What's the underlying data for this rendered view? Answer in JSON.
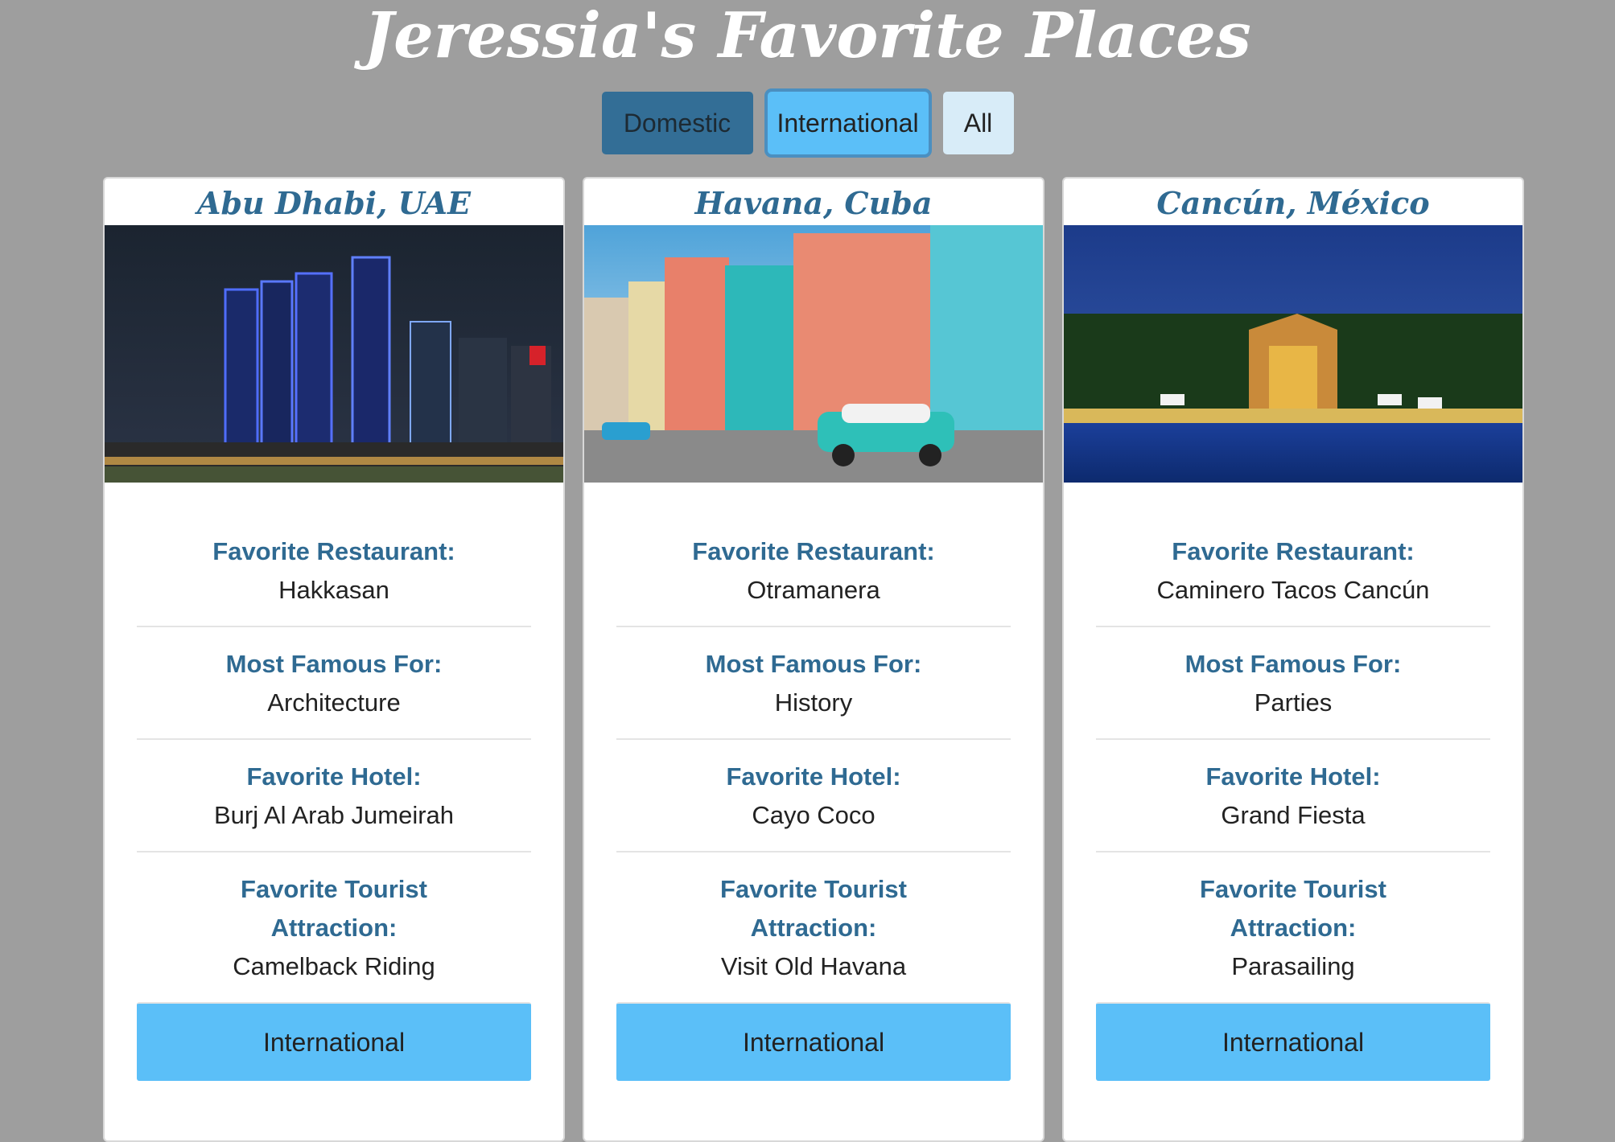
{
  "page": {
    "title": "Jeressia's Favorite Places"
  },
  "filters": {
    "domestic": "Domestic",
    "international": "International",
    "all": "All"
  },
  "cards": [
    {
      "city": "Abu Dhabi, UAE",
      "restaurant_label": "Favorite Restaurant:",
      "restaurant": "Hakkasan",
      "famous_label": "Most Famous For:",
      "famous": "Architecture",
      "hotel_label": "Favorite Hotel:",
      "hotel": "Burj Al Arab Jumeirah",
      "attraction_label": "Favorite Tourist Attraction:",
      "attraction": "Camelback Riding",
      "category": "International"
    },
    {
      "city": "Havana, Cuba",
      "restaurant_label": "Favorite Restaurant:",
      "restaurant": "Otramanera",
      "famous_label": "Most Famous For:",
      "famous": "History",
      "hotel_label": "Favorite Hotel:",
      "hotel": "Cayo Coco",
      "attraction_label": "Favorite Tourist Attraction:",
      "attraction": "Visit Old Havana",
      "category": "International"
    },
    {
      "city": "Cancún, México",
      "restaurant_label": "Favorite Restaurant:",
      "restaurant": "Caminero Tacos Cancún",
      "famous_label": "Most Famous For:",
      "famous": "Parties",
      "hotel_label": "Favorite Hotel:",
      "hotel": "Grand Fiesta",
      "attraction_label": "Favorite Tourist Attraction:",
      "attraction": "Parasailing",
      "category": "International"
    }
  ]
}
